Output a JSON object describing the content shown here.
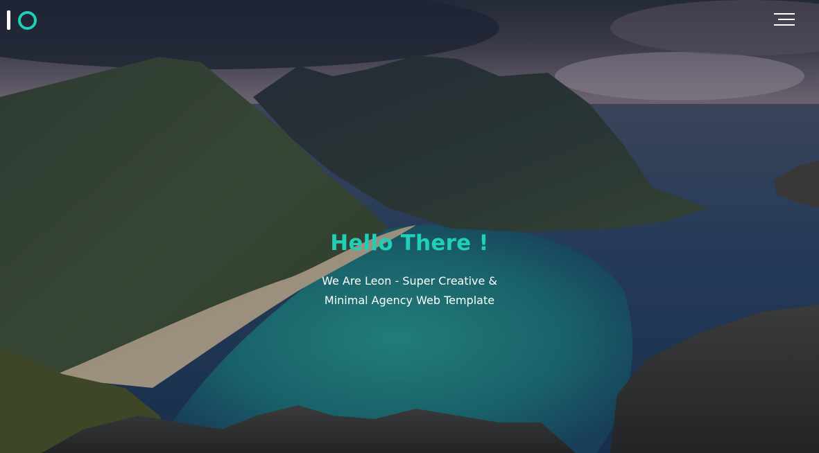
{
  "header": {
    "logo_icon": "io-logo-icon",
    "menu_icon": "hamburger-menu-icon"
  },
  "hero": {
    "title": "Hello There !",
    "subtitle_line1": "We Are Leon - Super Creative &",
    "subtitle_line2": "Minimal Agency Web Template"
  },
  "colors": {
    "accent": "#1fcfb6",
    "text": "#ffffff",
    "overlay": "#1f2a3a"
  }
}
